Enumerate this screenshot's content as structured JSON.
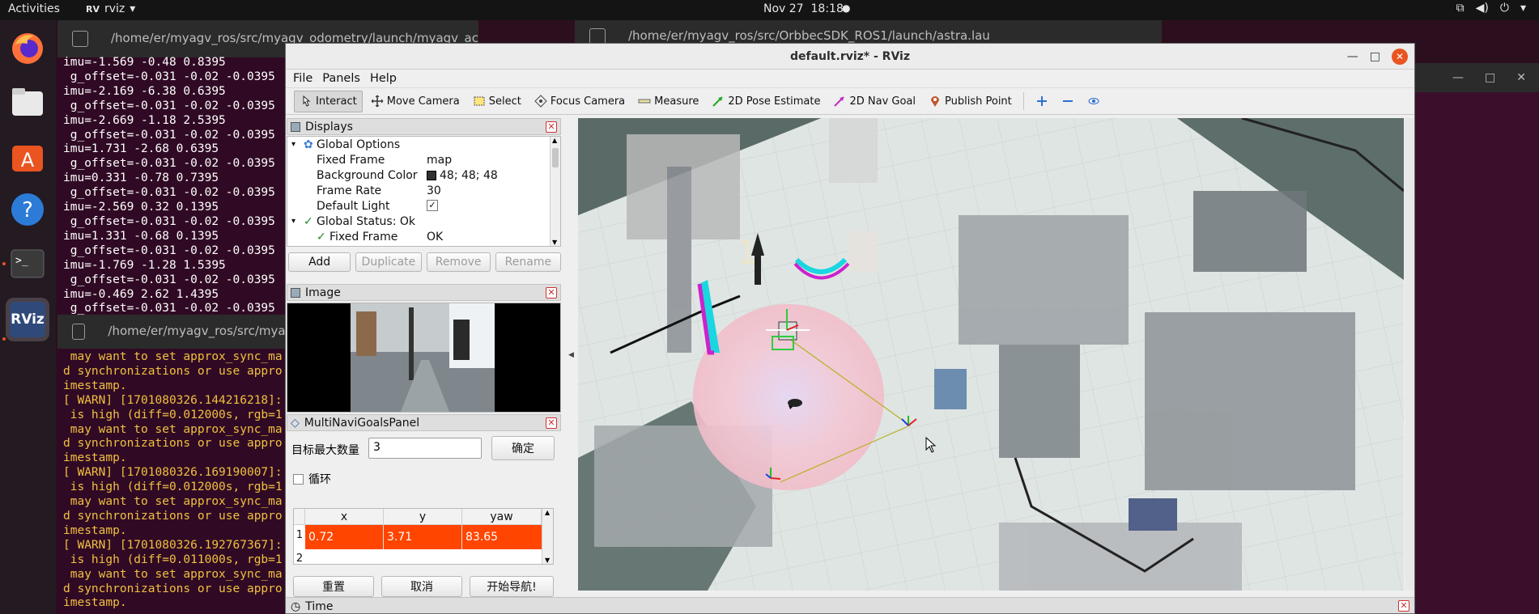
{
  "topbar": {
    "activities": "Activities",
    "app_name": "rviz",
    "date": "Nov 27",
    "time": "18:18",
    "dot": "●"
  },
  "dock": {
    "items": [
      "firefox-icon",
      "files-icon",
      "software-icon",
      "help-icon",
      "terminal-icon",
      "rviz-icon"
    ],
    "rviz_label": "RViz"
  },
  "terminal1": {
    "title": "/home/er/myagv_ros/src/myagv_odometry/launch/myagv_ac",
    "lines": [
      "imu=-1.569 -0.48 0.8395",
      " g_offset=-0.031 -0.02 -0.0395",
      "imu=-2.169 -6.38 0.6395",
      " g_offset=-0.031 -0.02 -0.0395",
      "imu=-2.669 -1.18 2.5395",
      " g_offset=-0.031 -0.02 -0.0395",
      "imu=1.731 -2.68 0.6395",
      " g_offset=-0.031 -0.02 -0.0395",
      "imu=0.331 -0.78 0.7395",
      " g_offset=-0.031 -0.02 -0.0395",
      "imu=-2.569 0.32 0.1395",
      " g_offset=-0.031 -0.02 -0.0395",
      "imu=1.331 -0.68 0.1395",
      " g_offset=-0.031 -0.02 -0.0395",
      "imu=-1.769 -1.28 1.5395",
      " g_offset=-0.031 -0.02 -0.0395",
      "imu=-0.469 2.62 1.4395",
      " g_offset=-0.031 -0.02 -0.0395"
    ]
  },
  "terminal2": {
    "title": "/home/er/myagv_ros/src/OrbbecSDK_ROS1/launch/astra.lau"
  },
  "terminal3": {
    "title": "/home/er/myagv_ros/src/myagv",
    "lines": [
      " may want to set approx_sync_ma",
      "d synchronizations or use appro",
      "imestamp.",
      "[ WARN] [1701080326.144216218]:",
      " is high (diff=0.012000s, rgb=1",
      " may want to set approx_sync_ma",
      "d synchronizations or use appro",
      "imestamp.",
      "[ WARN] [1701080326.169190007]:",
      " is high (diff=0.012000s, rgb=1",
      " may want to set approx_sync_ma",
      "d synchronizations or use appro",
      "imestamp.",
      "[ WARN] [1701080326.192767367]:",
      " is high (diff=0.011000s, rgb=1",
      " may want to set approx_sync_ma",
      "d synchronizations or use appro",
      "imestamp."
    ]
  },
  "rviz": {
    "window_title": "default.rviz* - RViz",
    "menu": [
      "File",
      "Panels",
      "Help"
    ],
    "tools": [
      {
        "label": "Interact",
        "icon": "interact-icon",
        "active": true
      },
      {
        "label": "Move Camera",
        "icon": "move-camera-icon"
      },
      {
        "label": "Select",
        "icon": "select-icon"
      },
      {
        "label": "Focus Camera",
        "icon": "focus-camera-icon"
      },
      {
        "label": "Measure",
        "icon": "measure-icon"
      },
      {
        "label": "2D Pose Estimate",
        "icon": "pose-estimate-icon"
      },
      {
        "label": "2D Nav Goal",
        "icon": "nav-goal-icon"
      },
      {
        "label": "Publish Point",
        "icon": "publish-point-icon"
      }
    ],
    "displays": {
      "title": "Displays",
      "rows": [
        {
          "key": "Global Options",
          "value": ""
        },
        {
          "key": "Fixed Frame",
          "value": "map"
        },
        {
          "key": "Background Color",
          "value": "48; 48; 48"
        },
        {
          "key": "Frame Rate",
          "value": "30"
        },
        {
          "key": "Default Light",
          "value": "✓"
        },
        {
          "key": "Global Status: Ok",
          "value": ""
        },
        {
          "key": "Fixed Frame",
          "value": "OK"
        }
      ],
      "buttons": [
        "Add",
        "Duplicate",
        "Remove",
        "Rename"
      ]
    },
    "image_panel": {
      "title": "Image"
    },
    "goals_panel": {
      "title": "MultiNaviGoalsPanel",
      "max_label": "目标最大数量",
      "max_value": "3",
      "confirm": "确定",
      "loop_label": "循环",
      "columns": [
        "x",
        "y",
        "yaw"
      ],
      "rows": [
        {
          "index": "1",
          "x": "0.72",
          "y": "3.71",
          "yaw": "83.65"
        }
      ],
      "next_row_index": "2",
      "buttons": [
        "重置",
        "取消",
        "开始导航!"
      ]
    },
    "time_panel": {
      "title": "Time"
    },
    "accent_color": "#ff4500",
    "background_color_swatch": "#303030"
  }
}
